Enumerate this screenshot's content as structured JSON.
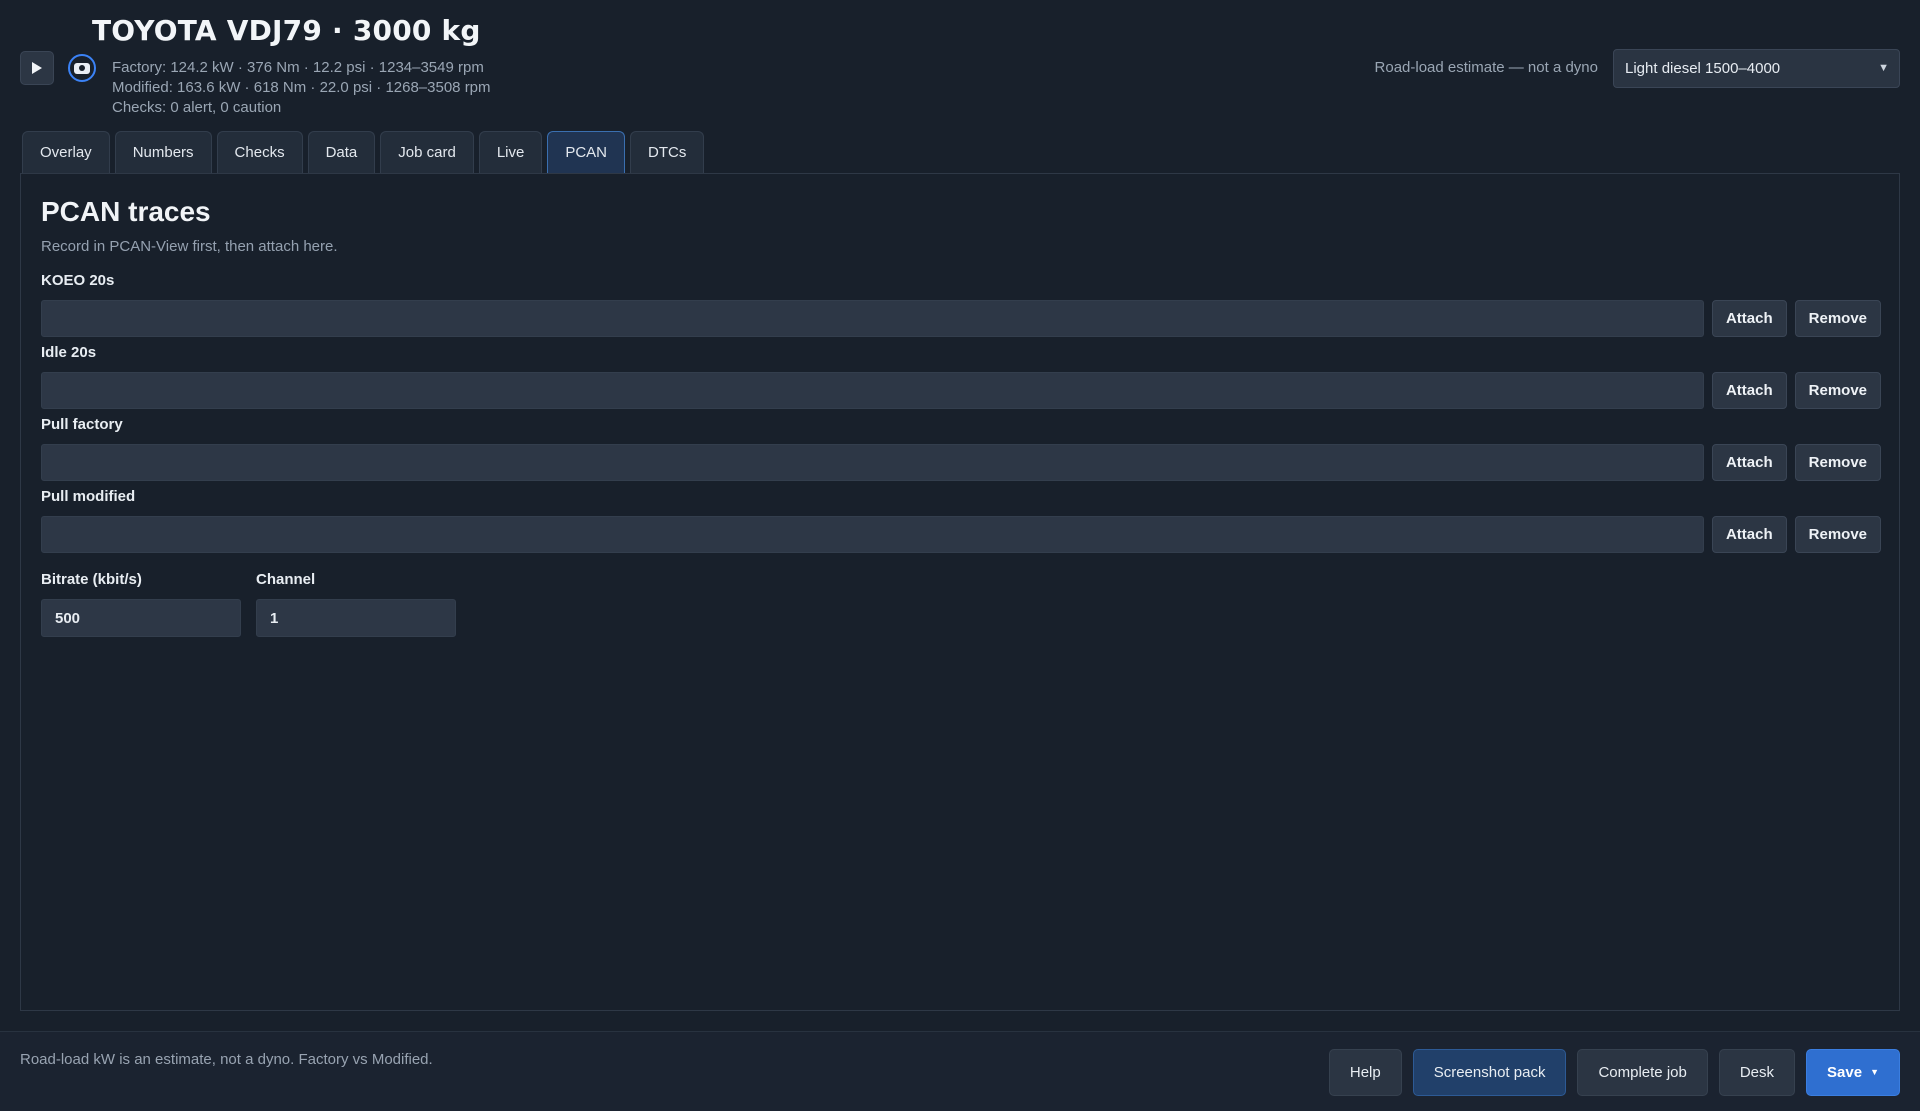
{
  "header": {
    "vehicle": "TOYOTA VDJ79",
    "separator": "·",
    "mass": "3000 kg",
    "factory_line": "Factory: 124.2 kW  ·  376 Nm  ·  12.2 psi  ·  1234–3549 rpm",
    "modified_line": "Modified: 163.6 kW  ·  618 Nm  ·  22.0 psi  ·  1268–3508 rpm",
    "checks_line": "Checks: 0 alert, 0 caution",
    "estimate_note": "Road-load estimate — not a dyno",
    "profile_select": "Light diesel 1500–4000",
    "icons": {
      "play": "play-icon",
      "record": "record-icon",
      "caret": "chevron-down-icon"
    }
  },
  "tabs": [
    {
      "label": "Overlay"
    },
    {
      "label": "Numbers"
    },
    {
      "label": "Checks"
    },
    {
      "label": "Data"
    },
    {
      "label": "Job card"
    },
    {
      "label": "Live"
    },
    {
      "label": "PCAN",
      "active": true
    },
    {
      "label": "DTCs"
    }
  ],
  "panel": {
    "title": "PCAN traces",
    "subtitle": "Record in PCAN-View first, then attach here.",
    "traces": [
      {
        "label": "KOEO 20s",
        "value": "",
        "attach": "Attach",
        "remove": "Remove"
      },
      {
        "label": "Idle 20s",
        "value": "",
        "attach": "Attach",
        "remove": "Remove"
      },
      {
        "label": "Pull factory",
        "value": "",
        "attach": "Attach",
        "remove": "Remove"
      },
      {
        "label": "Pull modified",
        "value": "",
        "attach": "Attach",
        "remove": "Remove"
      }
    ],
    "bitrate": {
      "label": "Bitrate (kbit/s)",
      "value": "500"
    },
    "channel": {
      "label": "Channel",
      "value": "1"
    }
  },
  "footer": {
    "note": "Road-load kW is an estimate, not a dyno. Factory vs Modified.",
    "buttons": {
      "help": "Help",
      "screenshot_pack": "Screenshot pack",
      "complete_job": "Complete job",
      "desk": "Desk",
      "save": "Save"
    }
  },
  "colors": {
    "background": "#18202b",
    "accent": "#2f6fd0",
    "active_tab": "#203452"
  }
}
